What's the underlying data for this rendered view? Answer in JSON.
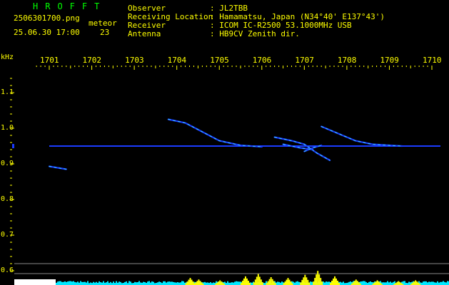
{
  "header": {
    "brand": "HROFFT",
    "filename": "2506301700.png",
    "datetime": "25.06.30 17:00",
    "meteor_label": "meteor",
    "meteor_count": "23",
    "labels": {
      "observer": "Observer",
      "location": "Receiving Location",
      "receiver": "Receiver",
      "antenna": "Antenna"
    },
    "values": {
      "observer": ": JL2TBB",
      "location": ": Hamamatsu, Japan (N34°40' E137°43')",
      "receiver": ": ICOM IC-R2500 53.1000MHz USB",
      "antenna": ": HB9CV Zenith dir."
    }
  },
  "axis": {
    "y_unit": "kHz",
    "x_ticks": [
      "1701",
      "1702",
      "1703",
      "1704",
      "1705",
      "1706",
      "1707",
      "1708",
      "1709",
      "1710"
    ],
    "y_ticks": [
      "1.1",
      "1.0",
      "0.9",
      "0.8",
      "0.7",
      "0.6"
    ]
  },
  "colors": {
    "background": "#000000",
    "header_yellow": "#ffff00",
    "brand_green": "#00ff00",
    "signal_blue": "#1a3cff",
    "echo_cyan": "#40e0ff",
    "meter_cyan": "#00e8ff",
    "meter_yellow": "#ffff00",
    "guide_gray": "#8a8a8a"
  },
  "chart_data": {
    "type": "scatter",
    "xlabel": "",
    "ylabel": "kHz",
    "xlim": [
      1700.6,
      1710.0
    ],
    "ylim": [
      0.58,
      1.2
    ],
    "x_ticks": [
      1701,
      1702,
      1703,
      1704,
      1705,
      1706,
      1707,
      1708,
      1709,
      1710
    ],
    "y_ticks": [
      1.1,
      1.0,
      0.9,
      0.8,
      0.7,
      0.6
    ],
    "grid": false,
    "carrier": {
      "frequency_khz": 0.95,
      "x_start": 1701.0,
      "x_end": 1710.0
    },
    "echoes": [
      {
        "points": [
          [
            1701.0,
            0.893
          ],
          [
            1701.4,
            0.885
          ]
        ]
      },
      {
        "points": [
          [
            1703.8,
            1.025
          ],
          [
            1704.2,
            1.015
          ],
          [
            1704.6,
            0.99
          ],
          [
            1705.0,
            0.965
          ],
          [
            1705.5,
            0.952
          ],
          [
            1706.0,
            0.948
          ]
        ]
      },
      {
        "points": [
          [
            1706.3,
            0.975
          ],
          [
            1706.7,
            0.965
          ],
          [
            1707.0,
            0.955
          ],
          [
            1707.3,
            0.93
          ],
          [
            1707.6,
            0.91
          ]
        ]
      },
      {
        "points": [
          [
            1706.5,
            0.955
          ],
          [
            1706.9,
            0.945
          ],
          [
            1707.2,
            0.94
          ]
        ]
      },
      {
        "points": [
          [
            1707.4,
            1.005
          ],
          [
            1707.8,
            0.985
          ],
          [
            1708.2,
            0.965
          ],
          [
            1708.6,
            0.955
          ],
          [
            1709.0,
            0.952
          ],
          [
            1709.3,
            0.95
          ]
        ]
      },
      {
        "points": [
          [
            1707.0,
            0.935
          ],
          [
            1707.2,
            0.945
          ],
          [
            1707.4,
            0.952
          ]
        ]
      }
    ],
    "meter": {
      "description_levels": "relative meteor echo power per time bin",
      "baseline": 0.12,
      "bursts": [
        {
          "x": 1704.3,
          "level": 0.45
        },
        {
          "x": 1704.5,
          "level": 0.35
        },
        {
          "x": 1705.0,
          "level": 0.3
        },
        {
          "x": 1705.6,
          "level": 0.55
        },
        {
          "x": 1705.9,
          "level": 0.7
        },
        {
          "x": 1706.2,
          "level": 0.5
        },
        {
          "x": 1706.6,
          "level": 0.45
        },
        {
          "x": 1707.0,
          "level": 0.65
        },
        {
          "x": 1707.3,
          "level": 0.9
        },
        {
          "x": 1707.7,
          "level": 0.55
        },
        {
          "x": 1708.2,
          "level": 0.35
        },
        {
          "x": 1708.7,
          "level": 0.3
        },
        {
          "x": 1709.2,
          "level": 0.25
        },
        {
          "x": 1709.6,
          "level": 0.3
        }
      ]
    }
  }
}
